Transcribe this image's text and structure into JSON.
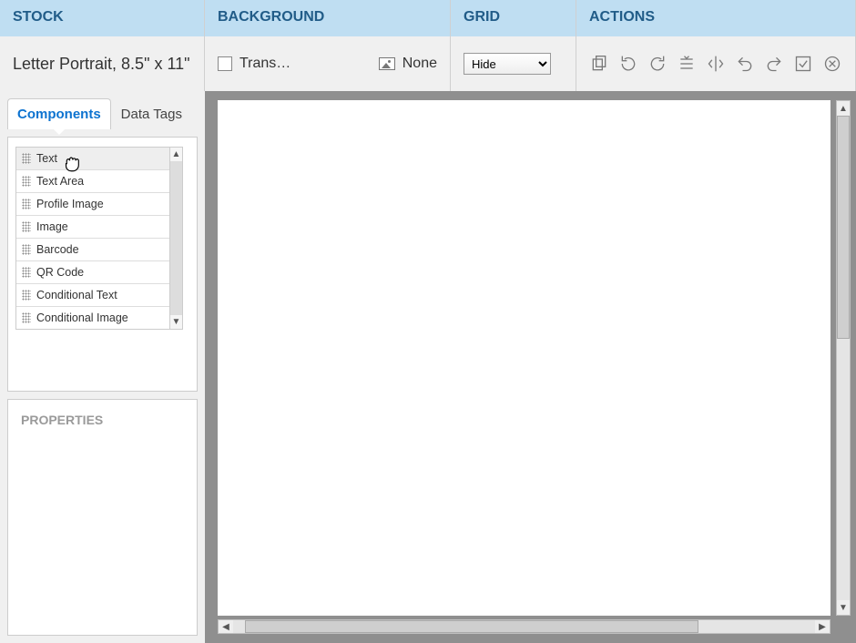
{
  "topbar": {
    "stock": {
      "header": "STOCK",
      "value": "Letter Portrait, 8.5\" x 11\""
    },
    "background": {
      "header": "BACKGROUND",
      "transparency_label": "Trans…",
      "image_label": "None"
    },
    "grid": {
      "header": "GRID",
      "value": "Hide"
    },
    "actions": {
      "header": "ACTIONS",
      "items": [
        "copy",
        "rotate-left",
        "rotate-right",
        "align",
        "flip",
        "undo",
        "redo",
        "confirm",
        "cancel"
      ]
    }
  },
  "sidebar": {
    "tabs": {
      "components": "Components",
      "data_tags": "Data Tags"
    },
    "components": [
      {
        "label": "Text"
      },
      {
        "label": "Text Area"
      },
      {
        "label": "Profile Image"
      },
      {
        "label": "Image"
      },
      {
        "label": "Barcode"
      },
      {
        "label": "QR Code"
      },
      {
        "label": "Conditional Text"
      },
      {
        "label": "Conditional Image"
      }
    ],
    "properties_header": "PROPERTIES"
  }
}
